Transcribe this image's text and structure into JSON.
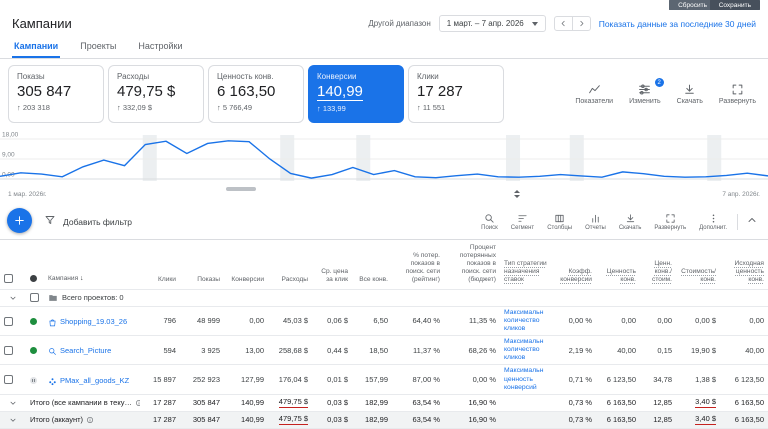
{
  "topbar": {
    "reset_label": "Сбросить",
    "save_label": "Сохранить"
  },
  "header": {
    "title": "Кампании",
    "range_label": "Другой диапазон",
    "date_value": "1 март. – 7 апр. 2026",
    "show_last_label": "Показать данные за последние 30 дней"
  },
  "tabs": [
    {
      "key": "campaigns",
      "label": "Кампании",
      "active": true
    },
    {
      "key": "projects",
      "label": "Проекты",
      "active": false
    },
    {
      "key": "settings",
      "label": "Настройки",
      "active": false
    }
  ],
  "scorecards": [
    {
      "key": "impressions",
      "label": "Показы",
      "value": "305 847",
      "delta": "203 318",
      "selected": false
    },
    {
      "key": "cost",
      "label": "Расходы",
      "value": "479,75 $",
      "delta": "332,09 $",
      "selected": false
    },
    {
      "key": "conv-value",
      "label": "Ценность конв.",
      "value": "6 163,50",
      "delta": "5 766,49",
      "selected": false
    },
    {
      "key": "conversions",
      "label": "Конверсии",
      "value": "140,99",
      "delta": "133,99",
      "selected": true
    },
    {
      "key": "clicks",
      "label": "Клики",
      "value": "17 287",
      "delta": "11 551",
      "selected": false
    }
  ],
  "metrics_toolbar": [
    {
      "key": "metrics",
      "label": "Показатели",
      "icon": "chart"
    },
    {
      "key": "edit",
      "label": "Изменить",
      "icon": "sliders",
      "badge": "2"
    },
    {
      "key": "download",
      "label": "Скачать",
      "icon": "download"
    },
    {
      "key": "expand",
      "label": "Развернуть",
      "icon": "expand"
    }
  ],
  "chart_data": {
    "type": "line",
    "x_start_label": "1 мар. 2026г.",
    "x_end_label": "7 апр. 2026г.",
    "ylim": [
      0,
      18
    ],
    "yticks": [
      {
        "value": 18,
        "label": "18,00"
      },
      {
        "value": 9,
        "label": "9,00"
      },
      {
        "value": 0,
        "label": "0,00"
      }
    ],
    "line_color": "#1a73e8",
    "values": [
      1.2,
      2.8,
      2.2,
      1,
      5.5,
      8.5,
      6,
      15.5,
      17,
      11.5,
      16,
      17.2,
      16.8,
      9,
      2.5,
      0.4,
      2,
      5.2,
      2,
      3.8,
      1,
      0.6,
      1.5,
      2.2,
      1,
      0.8,
      1.2,
      2,
      1.4,
      0.8,
      3.2,
      2.4,
      1.2,
      0.8,
      1,
      1.6,
      2.6,
      1.4
    ],
    "shaded_bands": [
      0.195,
      0.374,
      0.473,
      0.668,
      0.751,
      0.93
    ]
  },
  "filter_bar": {
    "add_filter_label": "Добавить фильтр",
    "actions": [
      {
        "key": "search",
        "label": "Поиск",
        "icon": "search"
      },
      {
        "key": "segment",
        "label": "Сегмент",
        "icon": "segment"
      },
      {
        "key": "columns",
        "label": "Столбцы",
        "icon": "columns"
      },
      {
        "key": "reports",
        "label": "Отчеты",
        "icon": "reports"
      },
      {
        "key": "download",
        "label": "Скачать",
        "icon": "download"
      },
      {
        "key": "expand",
        "label": "Развернуть",
        "icon": "expand"
      },
      {
        "key": "more",
        "label": "Дополнит.",
        "icon": "more"
      }
    ]
  },
  "table": {
    "columns": [
      {
        "key": "select",
        "label": ""
      },
      {
        "key": "status",
        "label": ""
      },
      {
        "key": "campaign",
        "label": "Кампания",
        "sort": true
      },
      {
        "key": "clicks",
        "label": "Клики",
        "num": true
      },
      {
        "key": "impressions",
        "label": "Показы",
        "num": true
      },
      {
        "key": "conversions",
        "label": "Конверсии",
        "num": true
      },
      {
        "key": "cost",
        "label": "Расходы",
        "num": true
      },
      {
        "key": "avg-cpc",
        "label": "Ср. цена за клик",
        "num": true
      },
      {
        "key": "all-conv",
        "label": "Все конв.",
        "num": true
      },
      {
        "key": "lost-is-rank",
        "label": "% потер. показов в поиск. сети (рейтинг)",
        "num": true
      },
      {
        "key": "lost-is-budget",
        "label": "Процент потерянных показов в поиск. сети (бюджет)",
        "num": true
      },
      {
        "key": "bid-strategy",
        "label": "Тип стратегии назначения ставок",
        "dotted": true
      },
      {
        "key": "conv-rate",
        "label": "Коэфф. конверсии",
        "num": true,
        "dotted": true
      },
      {
        "key": "conv-value",
        "label": "Ценность конв.",
        "num": true,
        "dotted": true
      },
      {
        "key": "value-per-cost",
        "label": "Ценн. конв./стоим.",
        "num": true,
        "dotted": true
      },
      {
        "key": "cost-per-conv",
        "label": "Стоимость/конв.",
        "num": true,
        "dotted": true
      },
      {
        "key": "orig-conv-value",
        "label": "Исходная ценность конв.",
        "num": true,
        "dotted": true
      }
    ],
    "rows": [
      {
        "type": "group",
        "label": "Всего проектов: 0"
      },
      {
        "type": "campaign",
        "status": "enabled",
        "icon": "shopping",
        "name": "Shopping_19.03_26",
        "cells": [
          "796",
          "48 999",
          "0,00",
          "45,03 $",
          "0,06 $",
          "6,50",
          "64,40 %",
          "11,35 %",
          "Максимальн количество кликов",
          "0,00 %",
          "0,00",
          "0,00",
          "0,00 $",
          "0,00"
        ]
      },
      {
        "type": "campaign",
        "status": "enabled",
        "icon": "search",
        "name": "Search_Picture",
        "cells": [
          "594",
          "3 925",
          "13,00",
          "258,68 $",
          "0,44 $",
          "18,50",
          "11,37 %",
          "68,26 %",
          "Максимальн количество кликов",
          "2,19 %",
          "40,00",
          "0,15",
          "19,90 $",
          "40,00"
        ]
      },
      {
        "type": "campaign",
        "status": "paused",
        "icon": "pmax",
        "name": "PMax_all_goods_KZ",
        "cells": [
          "15 897",
          "252 923",
          "127,99",
          "176,04 $",
          "0,01 $",
          "157,99",
          "87,00 %",
          "0,00 %",
          "Максимальн ценность конверсий",
          "0,71 %",
          "6 123,50",
          "34,78",
          "1,38 $",
          "6 123,50"
        ]
      },
      {
        "type": "total",
        "name": "Итого (все кампании в теку…",
        "info": true,
        "red": [
          3,
          12
        ],
        "cells": [
          "17 287",
          "305 847",
          "140,99",
          "479,75 $",
          "0,03 $",
          "182,99",
          "63,54 %",
          "16,90 %",
          "",
          "0,73 %",
          "6 163,50",
          "12,85",
          "3,40 $",
          "6 163,50"
        ]
      },
      {
        "type": "total",
        "name": "Итого (аккаунт)",
        "info": true,
        "shaded": true,
        "red": [
          3,
          12
        ],
        "cells": [
          "17 287",
          "305 847",
          "140,99",
          "479,75 $",
          "0,03 $",
          "182,99",
          "63,54 %",
          "16,90 %",
          "",
          "0,73 %",
          "6 163,50",
          "12,85",
          "3,40 $",
          "6 163,50"
        ]
      }
    ]
  }
}
